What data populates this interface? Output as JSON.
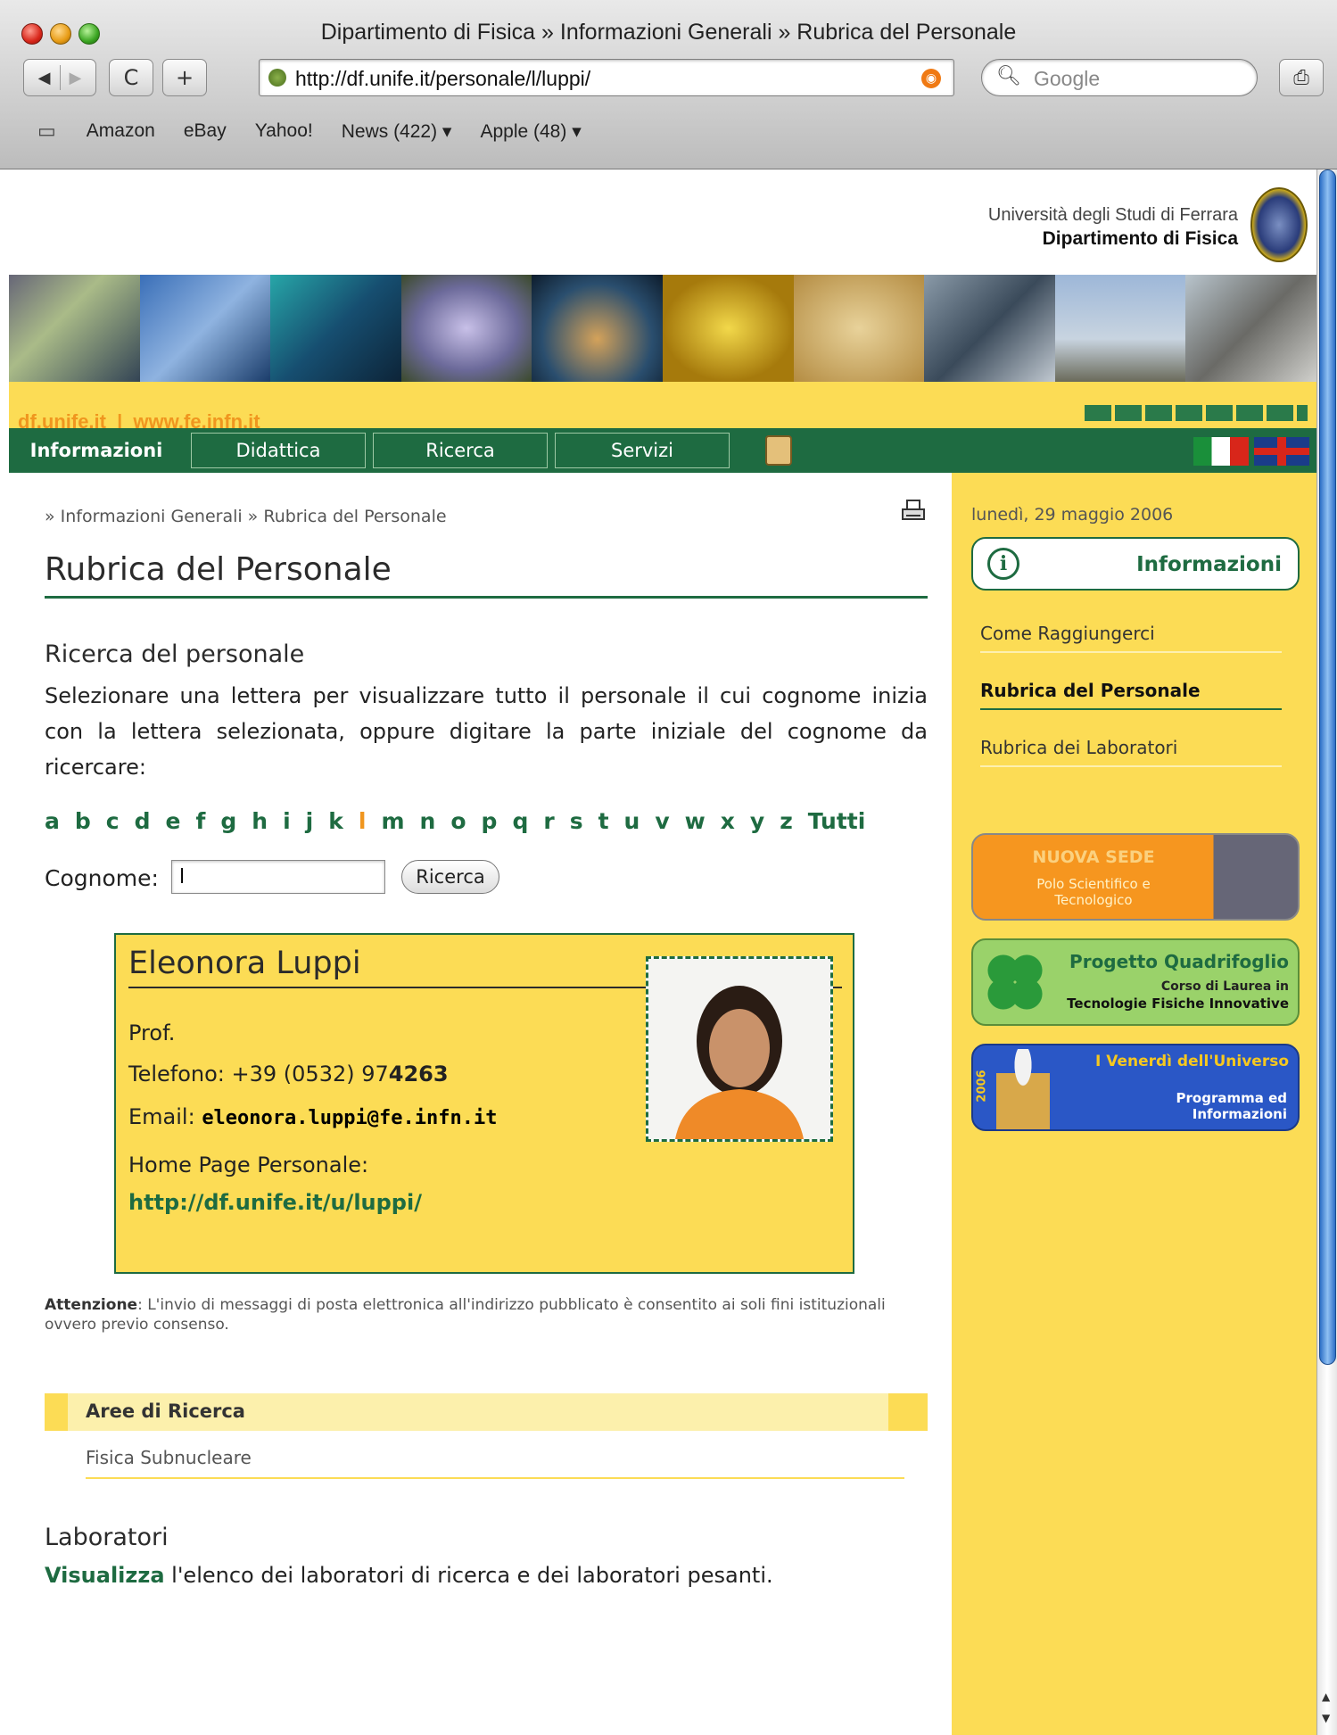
{
  "browser": {
    "window_title": "Dipartimento di Fisica » Informazioni Generali » Rubrica del Personale",
    "url": "http://df.unife.it/personale/l/luppi/",
    "search_placeholder": "Google",
    "reload_label": "C",
    "add_label": "+",
    "bookmarks": [
      "Amazon",
      "eBay",
      "Yahoo!",
      "News (422) ▾",
      "Apple (48) ▾"
    ]
  },
  "header": {
    "university": "Università degli Studi di Ferrara",
    "department": "Dipartimento di Fisica",
    "link1": "df.unife.it",
    "separator": "|",
    "link2": "www.fe.infn.it"
  },
  "nav": {
    "items": [
      "Informazioni",
      "Didattica",
      "Ricerca",
      "Servizi"
    ]
  },
  "main": {
    "breadcrumb": "» Informazioni Generali » Rubrica del Personale",
    "title": "Rubrica del Personale",
    "search_heading": "Ricerca del personale",
    "search_description": "Selezionare una lettera per visualizzare tutto il personale il cui cognome inizia con la lettera selezionata, oppure digitare la parte iniziale del cognome da ricercare:",
    "letters": [
      "a",
      "b",
      "c",
      "d",
      "e",
      "f",
      "g",
      "h",
      "i",
      "j",
      "k",
      "l",
      "m",
      "n",
      "o",
      "p",
      "q",
      "r",
      "s",
      "t",
      "u",
      "v",
      "w",
      "x",
      "y",
      "z",
      "Tutti"
    ],
    "active_letter": "l",
    "cognome_label": "Cognome:",
    "cognome_value": "l",
    "search_button": "Ricerca"
  },
  "card": {
    "name": "Eleonora Luppi",
    "role": "Prof.",
    "phone_label": "Telefono: +39 (0532) 97",
    "phone_ext": "4263",
    "email_label": "Email:",
    "email": "eleonora.luppi@fe.infn.it",
    "homepage_label": "Home Page Personale:",
    "homepage_url": "http://df.unife.it/u/luppi/"
  },
  "notice": {
    "label": "Attenzione",
    "text": ": L'invio di messaggi di posta elettronica all'indirizzo pubblicato è consentito ai soli fini istituzionali ovvero previo consenso."
  },
  "research": {
    "heading": "Aree di Ricerca",
    "area": "Fisica Subnucleare"
  },
  "labs": {
    "heading": "Laboratori",
    "link": "Visualizza",
    "text": " l'elenco dei laboratori di ricerca e dei laboratori pesanti."
  },
  "sidebar": {
    "date": "lunedì, 29 maggio 2006",
    "info_heading": "Informazioni",
    "links": [
      "Come Raggiungerci",
      "Rubrica del Personale",
      "Rubrica dei Laboratori"
    ],
    "active_link": "Rubrica del Personale",
    "promo1": {
      "title": "NUOVA SEDE",
      "subtitle": "Polo Scientifico e Tecnologico"
    },
    "promo2": {
      "title": "Progetto Quadrifoglio",
      "line1": "Corso di Laurea in",
      "line2": "Tecnologie Fisiche Innovative"
    },
    "promo3": {
      "year": "2006",
      "title": "I Venerdì dell'Universo",
      "line1": "Programma ed",
      "line2": "Informazioni"
    }
  },
  "colors": {
    "green": "#1e6b41",
    "yellow": "#fcdc55",
    "orange": "#f0961f"
  }
}
